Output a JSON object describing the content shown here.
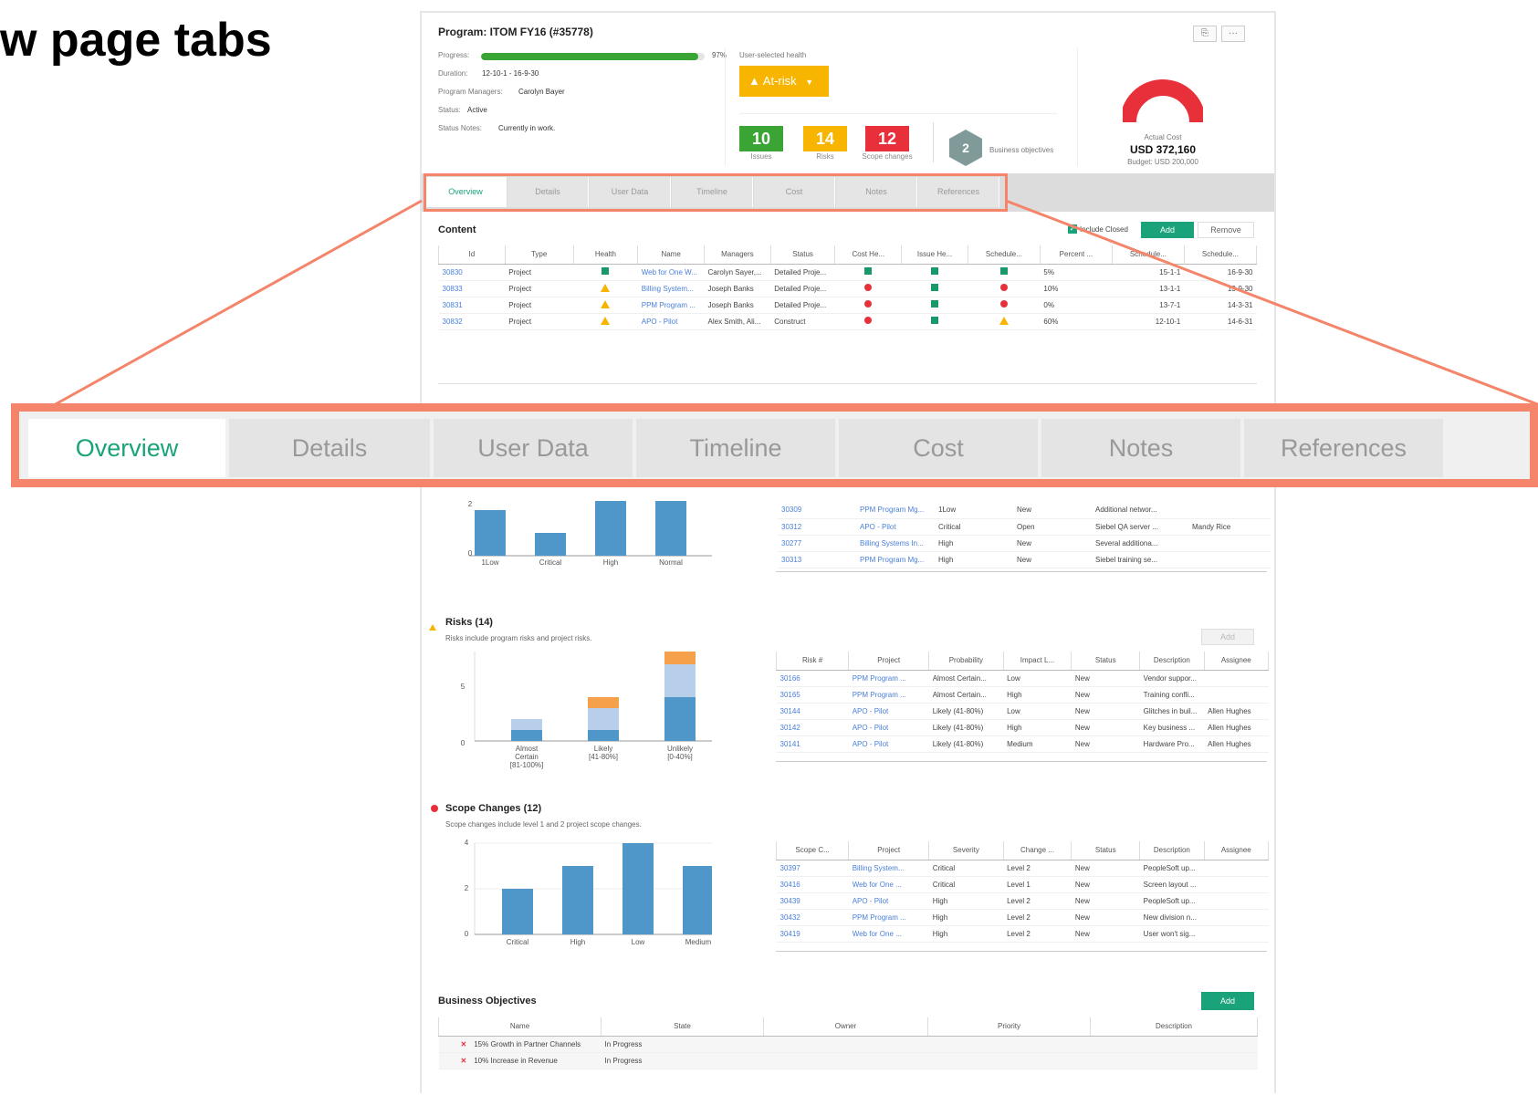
{
  "heading": "w page tabs",
  "program": {
    "title": "Program: ITOM FY16 (#35778)",
    "progress_label": "Progress:",
    "progress_value": "97%",
    "progress_fraction": 0.97,
    "duration_label": "Duration:",
    "duration_value": "12-10-1 - 16-9-30",
    "managers_label": "Program Managers:",
    "managers_value": "Carolyn Bayer",
    "status_label": "Status:",
    "status_value": "Active",
    "notes_label": "Status Notes:",
    "notes_value": "Currently in work.",
    "health_label": "User-selected health",
    "health_value": "At-risk",
    "issues_count": "10",
    "issues_label": "Issues",
    "risks_count": "14",
    "risks_label": "Risks",
    "scope_count": "12",
    "scope_label": "Scope changes",
    "objectives_count": "2",
    "objectives_label": "Business objectives",
    "actual_cost_label": "Actual Cost",
    "actual_cost_value": "USD 372,160",
    "budget_label": "Budget: USD 200,000",
    "export_icon": "export-icon",
    "more_icon": "more-icon"
  },
  "colors": {
    "green": "#1aa37a",
    "amber": "#f7b500",
    "red": "#e8303b",
    "bar_blue": "#4f96c9",
    "highlight": "#f4856a"
  },
  "tabs": [
    "Overview",
    "Details",
    "User Data",
    "Timeline",
    "Cost",
    "Notes",
    "References"
  ],
  "content": {
    "title": "Content",
    "include_closed": "Include Closed",
    "add": "Add",
    "remove": "Remove",
    "columns": [
      "Id",
      "Type",
      "Health",
      "Name",
      "Managers",
      "Status",
      "Cost He...",
      "Issue He...",
      "Schedule...",
      "Percent ...",
      "Schedule...",
      "Schedule..."
    ],
    "rows": [
      {
        "id": "30830",
        "type": "Project",
        "health": "green",
        "name": "Web for One W...",
        "managers": "Carolyn Sayer,...",
        "status": "Detailed Proje...",
        "cost": "green",
        "issue": "green",
        "schedule": "green",
        "percent": "5%",
        "start": "15-1-1",
        "end": "16-9-30"
      },
      {
        "id": "30833",
        "type": "Project",
        "health": "amber",
        "name": "Billing System...",
        "managers": "Joseph Banks",
        "status": "Detailed Proje...",
        "cost": "red",
        "issue": "green",
        "schedule": "red",
        "percent": "10%",
        "start": "13-1-1",
        "end": "13-9-30"
      },
      {
        "id": "30831",
        "type": "Project",
        "health": "amber",
        "name": "PPM Program ...",
        "managers": "Joseph Banks",
        "status": "Detailed Proje...",
        "cost": "red",
        "issue": "green",
        "schedule": "red",
        "percent": "0%",
        "start": "13-7-1",
        "end": "14-3-31"
      },
      {
        "id": "30832",
        "type": "Project",
        "health": "amber",
        "name": "APO - Pilot",
        "managers": "Alex Smith, Ali...",
        "status": "Construct",
        "cost": "red",
        "issue": "green",
        "schedule": "amber",
        "percent": "60%",
        "start": "12-10-1",
        "end": "14-6-31"
      }
    ]
  },
  "issues_section": {
    "chart": {
      "categories": [
        "1Low",
        "Critical",
        "High",
        "Normal"
      ],
      "values": [
        2,
        1,
        3,
        3
      ]
    },
    "rows": [
      {
        "id": "30309",
        "project": "PPM Program Mg...",
        "priority": "1Low",
        "status": "New",
        "description": "Additional networ...",
        "assignee": ""
      },
      {
        "id": "30312",
        "project": "APO - Pilot",
        "priority": "Critical",
        "status": "Open",
        "description": "Siebel QA server ...",
        "assignee": "Mandy Rice"
      },
      {
        "id": "30277",
        "project": "Billing Systems In...",
        "priority": "High",
        "status": "New",
        "description": "Several additiona...",
        "assignee": ""
      },
      {
        "id": "30313",
        "project": "PPM Program Mg...",
        "priority": "High",
        "status": "New",
        "description": "Siebel training se...",
        "assignee": ""
      }
    ]
  },
  "risks_section": {
    "title": "Risks (14)",
    "subtitle": "Risks include program risks and project risks.",
    "add": "Add",
    "chart": {
      "categories": [
        "Almost Certain [81-100%]",
        "Likely [41-80%]",
        "Unlikely [0-40%]"
      ],
      "category_lines": [
        [
          "Almost",
          "Certain",
          "[81-100%]"
        ],
        [
          "Likely",
          "[41-80%]"
        ],
        [
          "Unlikely",
          "[0-40%]"
        ]
      ],
      "series": [
        {
          "color": "#4f96c9",
          "values": [
            1,
            1,
            4
          ]
        },
        {
          "color": "#b7cfea",
          "values": [
            1,
            2,
            3
          ]
        },
        {
          "color": "#f5a04a",
          "values": [
            0,
            1,
            2
          ]
        }
      ],
      "ytick": "5",
      "ytick0": "0"
    },
    "columns": [
      "Risk #",
      "Project",
      "Probability",
      "Impact L...",
      "Status",
      "Description",
      "Assignee"
    ],
    "rows": [
      {
        "id": "30166",
        "project": "PPM Program ...",
        "probability": "Almost Certain...",
        "impact": "Low",
        "status": "New",
        "description": "Vendor suppor...",
        "assignee": ""
      },
      {
        "id": "30165",
        "project": "PPM Program ...",
        "probability": "Almost Certain...",
        "impact": "High",
        "status": "New",
        "description": "Training confli...",
        "assignee": ""
      },
      {
        "id": "30144",
        "project": "APO - Pilot",
        "probability": "Likely (41-80%)",
        "impact": "Low",
        "status": "New",
        "description": "Glitches in buil...",
        "assignee": "Allen Hughes"
      },
      {
        "id": "30142",
        "project": "APO - Pilot",
        "probability": "Likely (41-80%)",
        "impact": "High",
        "status": "New",
        "description": "Key business ...",
        "assignee": "Allen Hughes"
      },
      {
        "id": "30141",
        "project": "APO - Pilot",
        "probability": "Likely (41-80%)",
        "impact": "Medium",
        "status": "New",
        "description": "Hardware Pro...",
        "assignee": "Allen Hughes"
      }
    ]
  },
  "scope_section": {
    "title": "Scope Changes (12)",
    "subtitle": "Scope changes include level 1 and 2 project scope changes.",
    "chart": {
      "categories": [
        "Critical",
        "High",
        "Low",
        "Medium"
      ],
      "values": [
        2,
        3,
        4,
        3
      ],
      "ylim": [
        0,
        4
      ],
      "yticks": [
        "0",
        "2",
        "4"
      ]
    },
    "columns": [
      "Scope C...",
      "Project",
      "Severity",
      "Change ...",
      "Status",
      "Description",
      "Assignee"
    ],
    "rows": [
      {
        "id": "30397",
        "project": "Billing System...",
        "severity": "Critical",
        "change": "Level 2",
        "status": "New",
        "description": "PeopleSoft up...",
        "assignee": ""
      },
      {
        "id": "30416",
        "project": "Web for One ...",
        "severity": "Critical",
        "change": "Level 1",
        "status": "New",
        "description": "Screen layout ...",
        "assignee": ""
      },
      {
        "id": "30439",
        "project": "APO - Pilot",
        "severity": "High",
        "change": "Level 2",
        "status": "New",
        "description": "PeopleSoft up...",
        "assignee": ""
      },
      {
        "id": "30432",
        "project": "PPM Program ...",
        "severity": "High",
        "change": "Level 2",
        "status": "New",
        "description": "New division n...",
        "assignee": ""
      },
      {
        "id": "30419",
        "project": "Web for One ...",
        "severity": "High",
        "change": "Level 2",
        "status": "New",
        "description": "User won't sig...",
        "assignee": ""
      }
    ]
  },
  "objectives": {
    "title": "Business Objectives",
    "add": "Add",
    "columns": [
      "Name",
      "State",
      "Owner",
      "Priority",
      "Description"
    ],
    "rows": [
      {
        "name": "15% Growth in Partner Channels",
        "state": "In Progress"
      },
      {
        "name": "10% Increase in Revenue",
        "state": "In Progress"
      }
    ]
  }
}
